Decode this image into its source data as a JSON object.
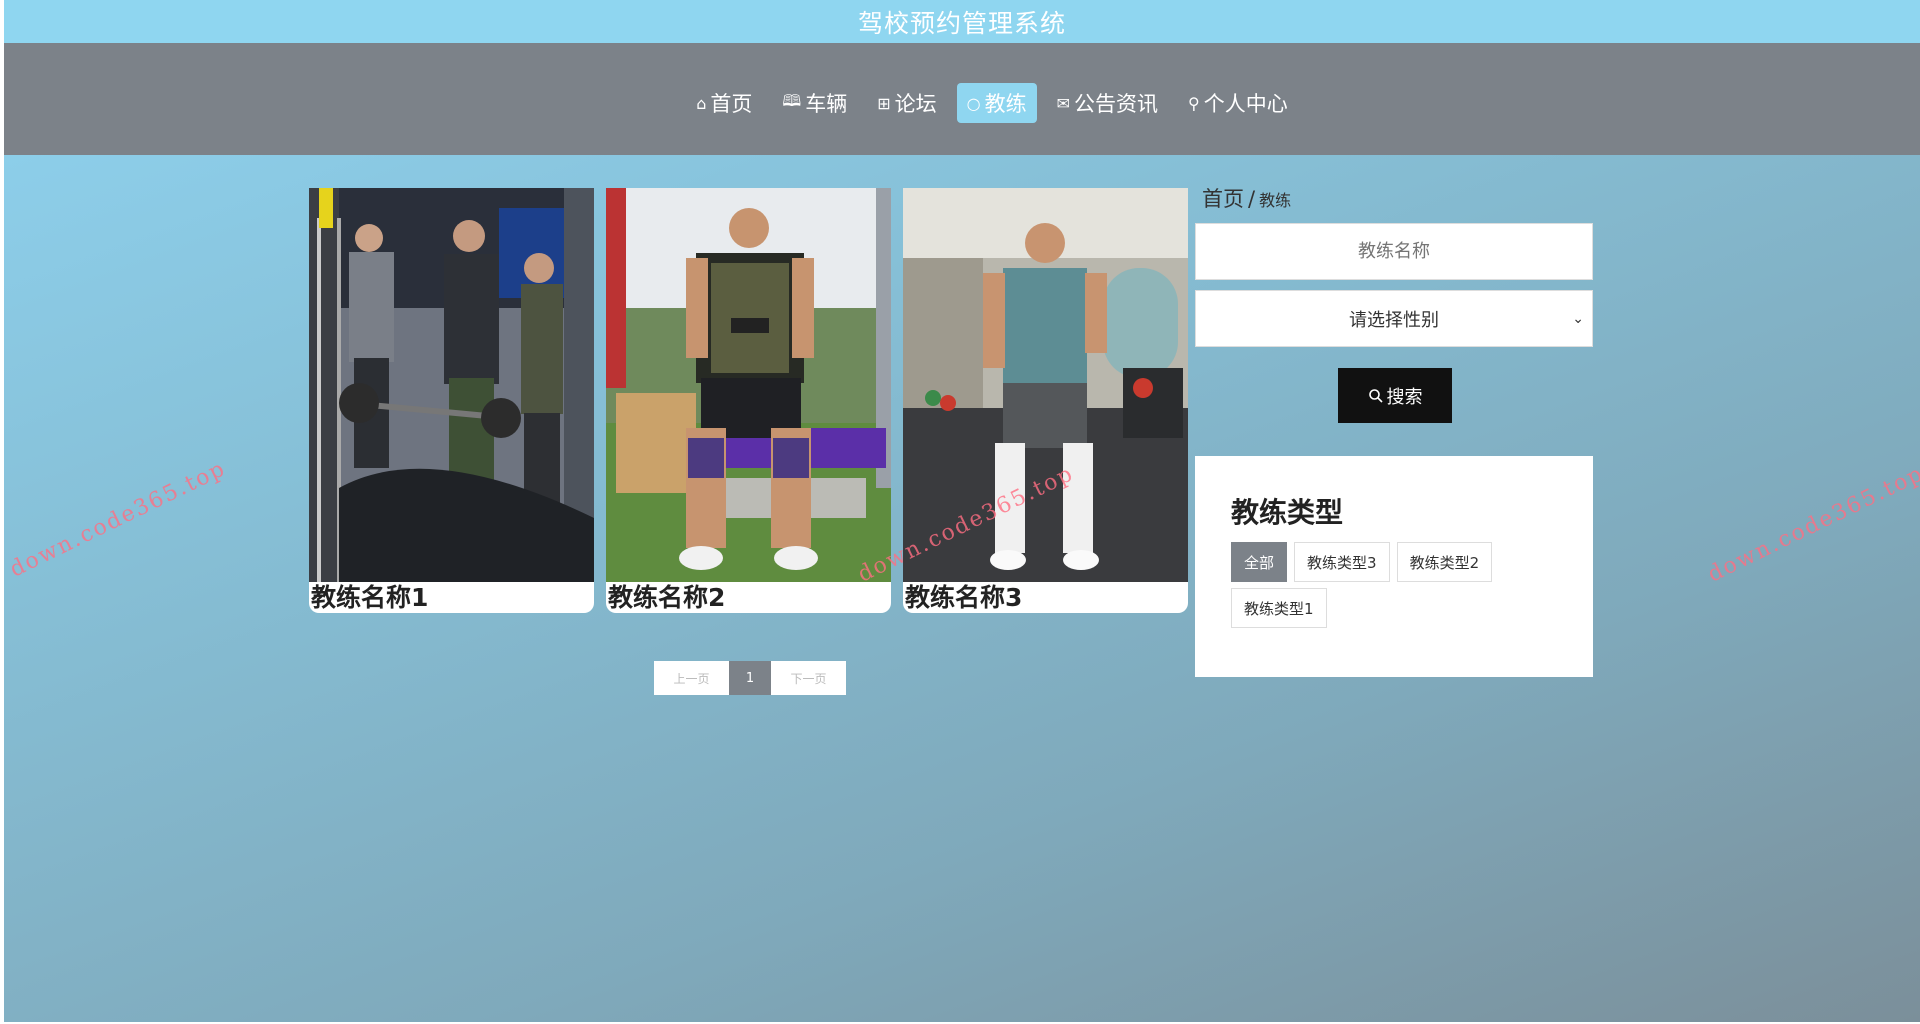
{
  "app": {
    "title": "驾校预约管理系统"
  },
  "nav": {
    "items": [
      {
        "label": "首页",
        "icon": "home-icon",
        "glyph": "⌂",
        "active": false
      },
      {
        "label": "车辆",
        "icon": "car-icon",
        "glyph": "🕮",
        "active": false
      },
      {
        "label": "论坛",
        "icon": "gift-icon",
        "glyph": "⊞",
        "active": false
      },
      {
        "label": "教练",
        "icon": "circle-icon",
        "glyph": "○",
        "active": true
      },
      {
        "label": "公告资讯",
        "icon": "mail-icon",
        "glyph": "✉",
        "active": false
      },
      {
        "label": "个人中心",
        "icon": "user-icon",
        "glyph": "⚲",
        "active": false
      }
    ]
  },
  "coaches": [
    {
      "name": "教练名称1"
    },
    {
      "name": "教练名称2"
    },
    {
      "name": "教练名称3"
    }
  ],
  "pager": {
    "prev": "上一页",
    "current": "1",
    "next": "下一页"
  },
  "breadcrumb": {
    "home": "首页",
    "sep": "/",
    "current": "教练"
  },
  "search": {
    "name_placeholder": "教练名称",
    "gender_placeholder": "请选择性别",
    "button_label": "搜索"
  },
  "types": {
    "title": "教练类型",
    "tags": [
      {
        "label": "全部",
        "active": true
      },
      {
        "label": "教练类型3",
        "active": false
      },
      {
        "label": "教练类型2",
        "active": false
      },
      {
        "label": "教练类型1",
        "active": false
      }
    ]
  },
  "watermark": "down.code365.top",
  "colors": {
    "header": "#8fd6f0",
    "nav": "#7c8289",
    "active": "#8fd6f0"
  }
}
